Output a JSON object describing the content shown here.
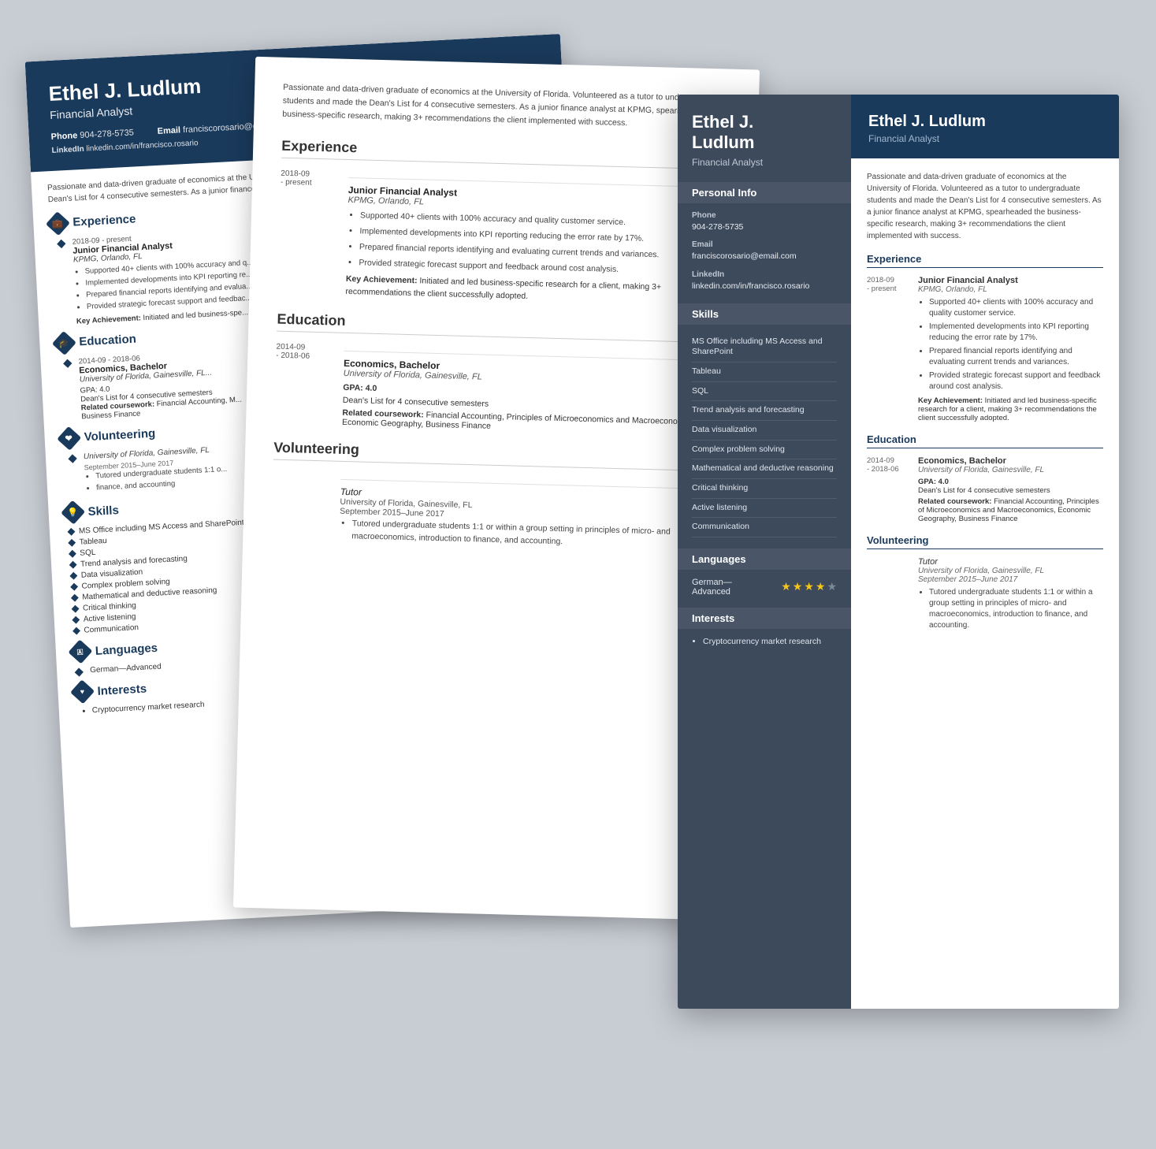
{
  "person": {
    "name": "Ethel J. Ludlum",
    "title": "Financial Analyst",
    "phone": "904-278-5735",
    "email": "franciscorosario@email.com",
    "linkedin": "linkedin.com/in/francisco.rosario"
  },
  "summary": "Passionate and data-driven graduate of economics at the University of Florida. Volunteered as a tutor to undergraduate students and made the Dean's List for 4 consecutive semesters. As a junior finance analyst at KPMG, spearheaded the business-specific research, making 3+ recommendations the client implemented with success.",
  "experience": {
    "section_label": "Experience",
    "entries": [
      {
        "date_start": "2018-09",
        "date_end": "present",
        "title": "Junior Financial Analyst",
        "company": "KPMG, Orlando, FL",
        "bullets": [
          "Supported 40+ clients with 100% accuracy and quality customer service.",
          "Implemented developments into KPI reporting reducing the error rate by 17%.",
          "Prepared financial reports identifying and evaluating current trends and variances.",
          "Provided strategic forecast support and feedback around cost analysis."
        ],
        "key_achievement": "Initiated and led business-specific research for a client, making 3+ recommendations the client successfully adopted."
      }
    ]
  },
  "education": {
    "section_label": "Education",
    "entries": [
      {
        "date_start": "2014-09",
        "date_end": "2018-06",
        "degree": "Economics, Bachelor",
        "school": "University of Florida, Gainesville, FL",
        "gpa": "GPA: 4.0",
        "honors": "Dean's List for 4 consecutive semesters",
        "coursework_label": "Related coursework:",
        "coursework": "Financial Accounting, Principles of Microeconomics and Macroeconomics, Economic Geography, Business Finance"
      }
    ]
  },
  "volunteering": {
    "section_label": "Volunteering",
    "entries": [
      {
        "title": "Tutor",
        "org": "University of Florida, Gainesville, FL",
        "dates": "September 2015–June 2017",
        "bullets": [
          "Tutored undergraduate students 1:1 or within a group setting in principles of micro- and macroeconomics, introduction to finance, and accounting."
        ]
      }
    ]
  },
  "skills": {
    "section_label": "Skills",
    "items": [
      "MS Office including MS Access and SharePoint",
      "Tableau",
      "SQL",
      "Trend analysis and forecasting",
      "Data visualization",
      "Complex problem solving",
      "Mathematical and deductive reasoning",
      "Critical thinking",
      "Active listening",
      "Communication"
    ]
  },
  "languages": {
    "section_label": "Languages",
    "items": [
      {
        "name": "German—Advanced",
        "stars": 4,
        "max_stars": 5
      }
    ]
  },
  "interests": {
    "section_label": "Interests",
    "items": [
      "Cryptocurrency market research"
    ]
  },
  "resume_back": {
    "header_name": "Ethel J. Ludlum",
    "header_title": "Financial Analyst",
    "phone_label": "Phone",
    "email_label": "Email",
    "linkedin_label": "LinkedIn"
  },
  "resume_mid": {
    "experience_label": "Experience",
    "education_label": "Education",
    "volunteering_label": "Volunteering"
  }
}
